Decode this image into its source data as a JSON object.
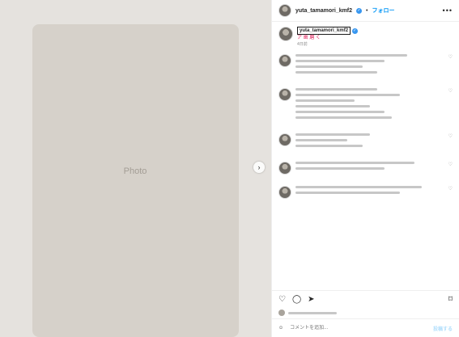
{
  "header": {
    "handle": "yuta_tamamori_kmf2",
    "follow_label": "フォロー",
    "more_label": "•••"
  },
  "caption": {
    "handle": "yuta_tamamori_kmf2",
    "text": "ア 歯 磨 く",
    "time": "4日前"
  },
  "comments": [
    {
      "lines": [
        0.75,
        0.6,
        0.45,
        0.55
      ]
    },
    {
      "lines": [
        0.55,
        0.7,
        0.4,
        0.5,
        0.6,
        0.65
      ]
    },
    {
      "lines": [
        0.5,
        0.35,
        0.45
      ]
    },
    {
      "lines": [
        0.8,
        0.6
      ]
    },
    {
      "lines": [
        0.85,
        0.7
      ]
    }
  ],
  "icons": {
    "like": "heart-icon",
    "comment": "comment-icon",
    "share": "paper-plane-icon",
    "save": "bookmark-icon",
    "emoji": "emoji-icon",
    "next": "chevron-right-icon"
  },
  "input": {
    "placeholder": "コメントを追加...",
    "post_label": "投稿する"
  },
  "colors": {
    "accent": "#0095f6",
    "caption_text": "#e0245e"
  }
}
